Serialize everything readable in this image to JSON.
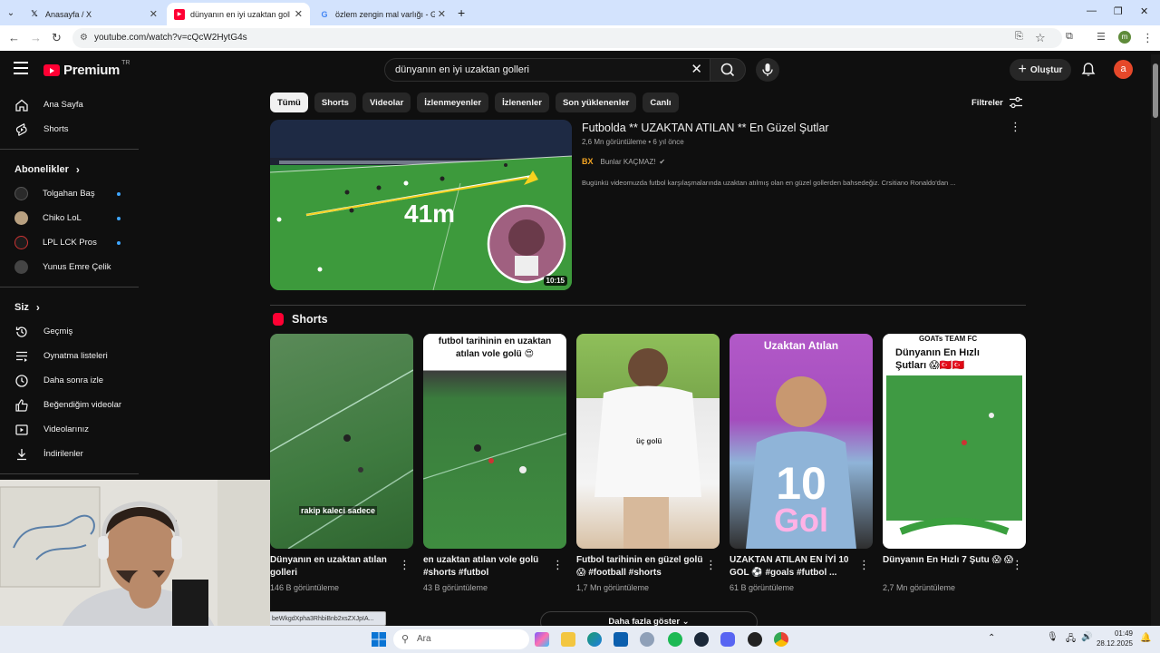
{
  "browser": {
    "tabs": [
      {
        "title": "Anasayfa / X",
        "icon": "x-logo-icon"
      },
      {
        "title": "dünyanın en iyi uzaktan golleri",
        "icon": "youtube-icon",
        "active": true
      },
      {
        "title": "özlem zengin mal varlığı - Goog",
        "icon": "google-icon"
      }
    ],
    "url": "youtube.com/watch?v=cQcW2HytG4s",
    "profile_initial": "m",
    "status_url": "beWkgdXpha3RhbiBnb2xsZXJpIA..."
  },
  "yt": {
    "logo_text": "Premium",
    "logo_region": "TR",
    "search_query": "dünyanın en iyi uzaktan golleri",
    "create_label": "Oluştur",
    "avatar_initial": "a"
  },
  "sidebar": {
    "main": [
      {
        "label": "Ana Sayfa",
        "icon": "home-icon"
      },
      {
        "label": "Shorts",
        "icon": "shorts-icon"
      }
    ],
    "subs_heading": "Abonelikler",
    "subs": [
      {
        "label": "Tolgahan Baş",
        "color": "#2a2a2a",
        "dot": true
      },
      {
        "label": "Chiko LoL",
        "color": "#b8a080",
        "dot": true
      },
      {
        "label": "LPL LCK Pros",
        "color": "#1c1c1c",
        "dot": true
      },
      {
        "label": "Yunus Emre Çelik",
        "color": "#444444",
        "dot": false
      }
    ],
    "you_heading": "Siz",
    "you": [
      {
        "label": "Geçmiş",
        "icon": "history-icon"
      },
      {
        "label": "Oynatma listeleri",
        "icon": "playlists-icon"
      },
      {
        "label": "Daha sonra izle",
        "icon": "watch-later-icon"
      },
      {
        "label": "Beğendiğim videolar",
        "icon": "like-icon"
      },
      {
        "label": "Videolarınız",
        "icon": "your-videos-icon"
      },
      {
        "label": "İndirilenler",
        "icon": "downloads-icon"
      }
    ]
  },
  "chips": [
    "Tümü",
    "Shorts",
    "Videolar",
    "İzlenmeyenler",
    "İzlenenler",
    "Son yüklenenler",
    "Canlı"
  ],
  "filters_label": "Filtreler",
  "video": {
    "title": "Futbolda ** UZAKTAN ATILAN ** En Güzel Şutlar",
    "views": "2,6 Mn görüntüleme",
    "age": "6 yıl önce",
    "channel": "Bunlar KAÇMAZ!",
    "channel_badge": "BX",
    "description": "Bugünkü videomuzda futbol karşılaşmalarında uzaktan atılmış olan en güzel gollerden bahsedeğiz. Crsitiano Ronaldo'dan ...",
    "duration": "10:15",
    "overlay_text": "41m"
  },
  "shorts_heading": "Shorts",
  "shorts": [
    {
      "title": "Dünyanın en uzaktan atılan golleri",
      "views": "146 B görüntüleme",
      "overlay": "rakip kaleci sadece"
    },
    {
      "title": "en uzaktan atılan vole golü #shorts #futbol",
      "views": "43 B görüntüleme",
      "overlay": "futbol tarihinin en uzaktan atılan vole golü 😍"
    },
    {
      "title": "Futbol tarihinin en güzel golü 😱 #football #shorts",
      "views": "1,7 Mn görüntüleme",
      "overlay": "üç golü"
    },
    {
      "title": "UZAKTAN ATILAN EN İYİ 10 GOL ⚽ #goals #futbol ...",
      "views": "61 B görüntüleme",
      "overlay": "Uzaktan Atılan",
      "overlay2": "10",
      "overlay3": "Gol"
    },
    {
      "title": "Dünyanın En Hızlı 7 Şutu 😱 😱",
      "views": "2,7 Mn görüntüleme",
      "overlay": "Dünyanın En Hızlı Şutları 😱🇹🇷🇹🇷",
      "overlay_top": "GOATs TEAM FC"
    }
  ],
  "show_more": "Daha fazla göster",
  "taskbar": {
    "search_placeholder": "Ara",
    "time": "01:49",
    "date": "28.12.2025"
  }
}
